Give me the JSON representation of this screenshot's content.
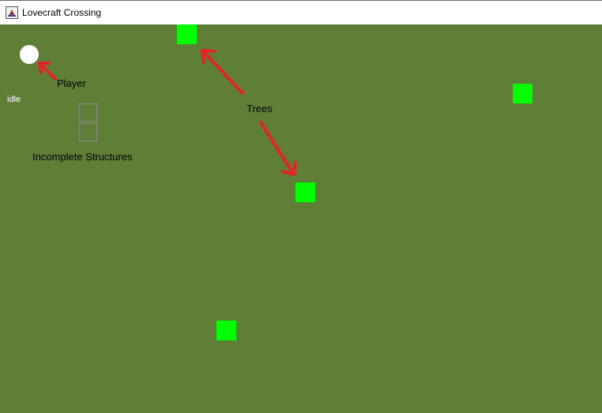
{
  "window": {
    "title": "Lovecraft Crossing",
    "icon": "java-app-icon"
  },
  "game": {
    "background_color": "#5f7f37",
    "tree_color": "#00ff00",
    "player": {
      "state": "idle",
      "color": "#ffffff"
    },
    "trees_count": 4,
    "incomplete_structures_count": 2
  },
  "annotations": {
    "player_label": "Player",
    "trees_label": "Trees",
    "structures_label": "Incomplete Structures",
    "arrow_color": "#e8202a"
  }
}
